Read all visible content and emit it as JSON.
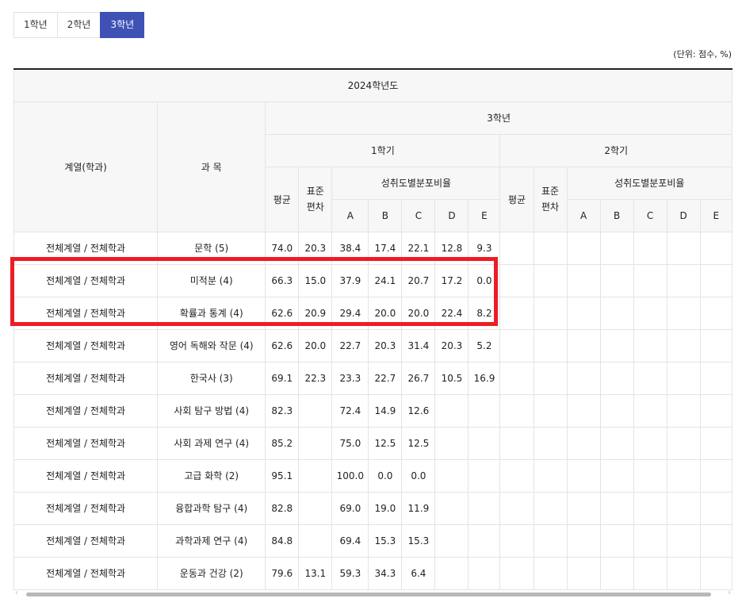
{
  "tabs": [
    {
      "label": "1학년",
      "active": false
    },
    {
      "label": "2학년",
      "active": false
    },
    {
      "label": "3학년",
      "active": true
    }
  ],
  "unit_note": "(단위: 점수, %)",
  "table": {
    "year_header": "2024학년도",
    "col_dept": "계열(학과)",
    "col_subject": "과 목",
    "grade_header": "3학년",
    "sem1": "1학기",
    "sem2": "2학기",
    "avg": "평균",
    "std": "표준\n편차",
    "dist": "성취도별분포비율",
    "grades": [
      "A",
      "B",
      "C",
      "D",
      "E"
    ],
    "rows": [
      {
        "dept": "전체계열 / 전체학과",
        "subject": "문학 (5)",
        "cells": [
          "74.0",
          "20.3",
          "38.4",
          "17.4",
          "22.1",
          "12.8",
          "9.3"
        ]
      },
      {
        "dept": "전체계열 / 전체학과",
        "subject": "미적분 (4)",
        "cells": [
          "66.3",
          "15.0",
          "37.9",
          "24.1",
          "20.7",
          "17.2",
          "0.0"
        ]
      },
      {
        "dept": "전체계열 / 전체학과",
        "subject": "확률과 통계 (4)",
        "cells": [
          "62.6",
          "20.9",
          "29.4",
          "20.0",
          "20.0",
          "22.4",
          "8.2"
        ]
      },
      {
        "dept": "전체계열 / 전체학과",
        "subject": "영어 독해와 작문 (4)",
        "cells": [
          "62.6",
          "20.0",
          "22.7",
          "20.3",
          "31.4",
          "20.3",
          "5.2"
        ]
      },
      {
        "dept": "전체계열 / 전체학과",
        "subject": "한국사 (3)",
        "cells": [
          "69.1",
          "22.3",
          "23.3",
          "22.7",
          "26.7",
          "10.5",
          "16.9"
        ]
      },
      {
        "dept": "전체계열 / 전체학과",
        "subject": "사회 탐구 방법 (4)",
        "cells": [
          "82.3",
          "",
          "72.4",
          "14.9",
          "12.6",
          "",
          ""
        ]
      },
      {
        "dept": "전체계열 / 전체학과",
        "subject": "사회 과제 연구 (4)",
        "cells": [
          "85.2",
          "",
          "75.0",
          "12.5",
          "12.5",
          "",
          ""
        ]
      },
      {
        "dept": "전체계열 / 전체학과",
        "subject": "고급 화학 (2)",
        "cells": [
          "95.1",
          "",
          "100.0",
          "0.0",
          "0.0",
          "",
          ""
        ]
      },
      {
        "dept": "전체계열 / 전체학과",
        "subject": "융합과학 탐구 (4)",
        "cells": [
          "82.8",
          "",
          "69.0",
          "19.0",
          "11.9",
          "",
          ""
        ]
      },
      {
        "dept": "전체계열 / 전체학과",
        "subject": "과학과제 연구 (4)",
        "cells": [
          "84.8",
          "",
          "69.4",
          "15.3",
          "15.3",
          "",
          ""
        ]
      },
      {
        "dept": "전체계열 / 전체학과",
        "subject": "운동과 건강 (2)",
        "cells": [
          "79.6",
          "13.1",
          "59.3",
          "34.3",
          "6.4",
          "",
          ""
        ]
      }
    ]
  },
  "scroll": {
    "left_arrow": "‹",
    "right_arrow": "›"
  }
}
